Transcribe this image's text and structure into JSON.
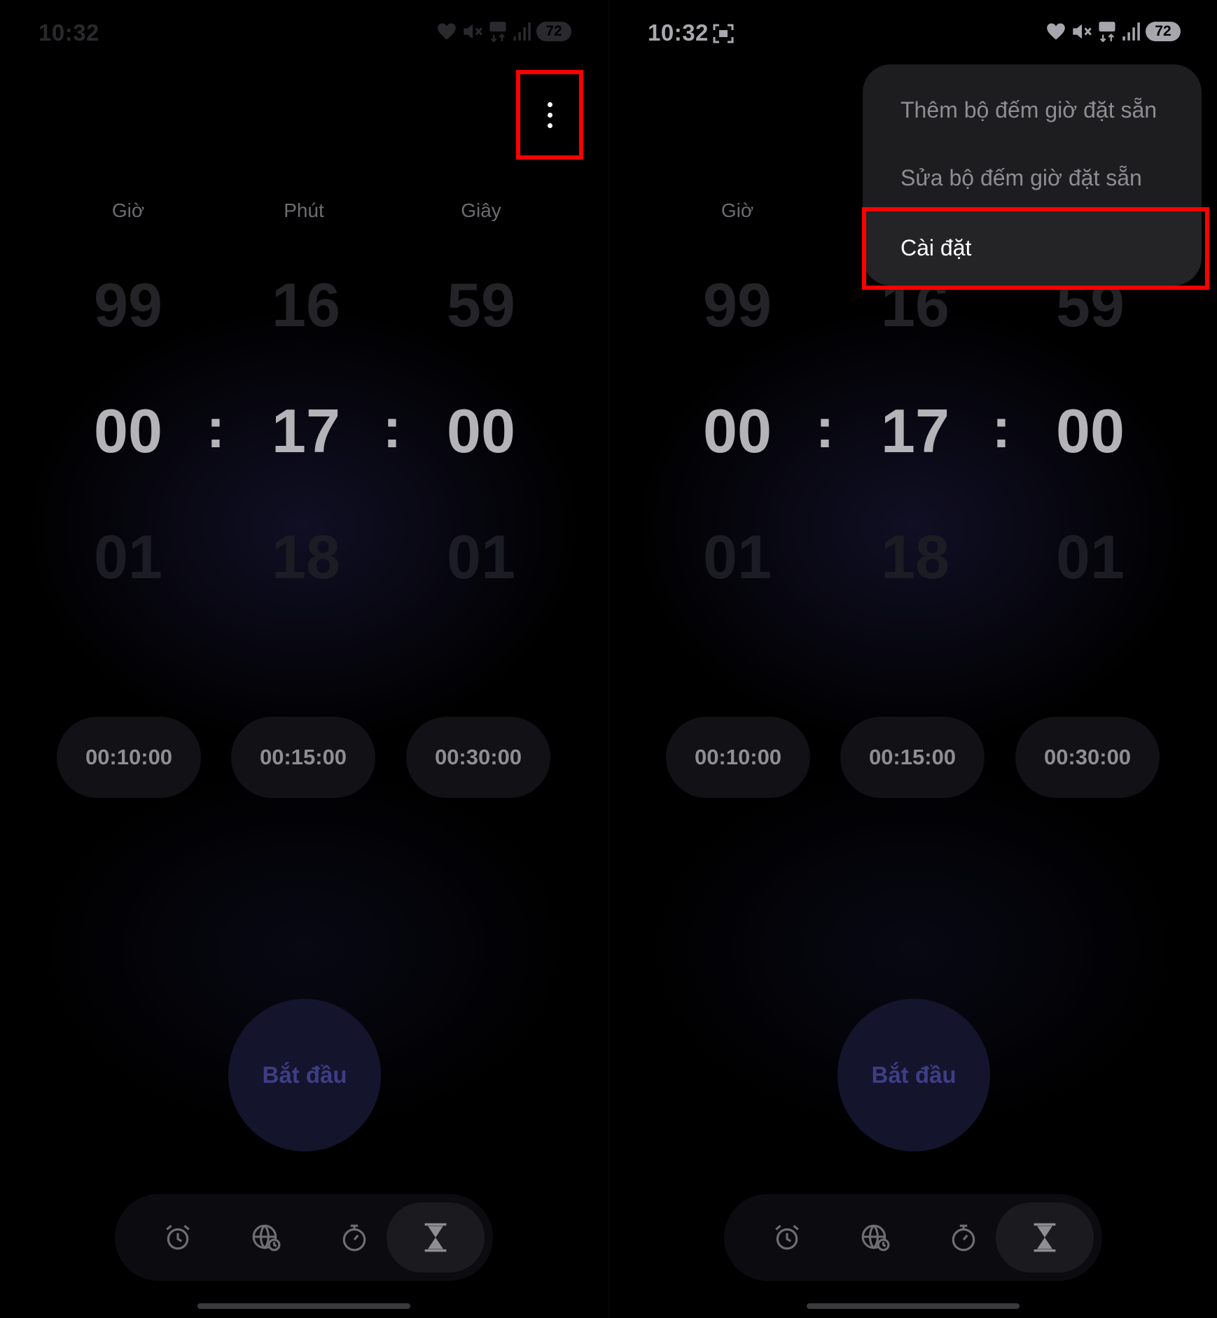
{
  "left": {
    "status": {
      "time": "10:32",
      "battery": "72",
      "icons": [
        "heart-icon",
        "mute-icon",
        "5g-icon",
        "signal-icon"
      ]
    },
    "overflow_icon": "more-vertical-icon",
    "labels": {
      "hours": "Giờ",
      "minutes": "Phút",
      "seconds": "Giây"
    },
    "picker": {
      "prev": {
        "hours": "99",
        "minutes": "16",
        "seconds": "59"
      },
      "current": {
        "hours": "00",
        "minutes": "17",
        "seconds": "00"
      },
      "next": {
        "hours": "01",
        "minutes": "18",
        "seconds": "01"
      },
      "separator": ":"
    },
    "presets": [
      "00:10:00",
      "00:15:00",
      "00:30:00"
    ],
    "start_label": "Bắt đầu",
    "nav": [
      "alarm-icon",
      "world-clock-icon",
      "stopwatch-icon",
      "timer-icon"
    ],
    "active_nav": "timer-icon"
  },
  "right": {
    "status": {
      "time": "10:32",
      "battery": "72",
      "icons": [
        "screenshot-icon",
        "heart-icon",
        "mute-icon",
        "5g-icon",
        "signal-icon"
      ]
    },
    "labels": {
      "hours": "Giờ"
    },
    "picker": {
      "prev": {
        "hours": "99",
        "minutes": "16",
        "seconds": "59"
      },
      "current": {
        "hours": "00",
        "minutes": "17",
        "seconds": "00"
      },
      "next": {
        "hours": "01",
        "minutes": "18",
        "seconds": "01"
      },
      "separator": ":"
    },
    "menu": [
      {
        "label": "Thêm bộ đếm giờ đặt sẵn"
      },
      {
        "label": "Sửa bộ đếm giờ đặt sẵn"
      },
      {
        "label": "Cài đặt"
      }
    ],
    "selected_menu": "Cài đặt",
    "presets": [
      "00:10:00",
      "00:15:00",
      "00:30:00"
    ],
    "start_label": "Bắt đầu",
    "nav": [
      "alarm-icon",
      "world-clock-icon",
      "stopwatch-icon",
      "timer-icon"
    ],
    "active_nav": "timer-icon"
  },
  "colors": {
    "highlight": "#ff0000",
    "accent": "#3e3e86",
    "background": "#000000"
  }
}
